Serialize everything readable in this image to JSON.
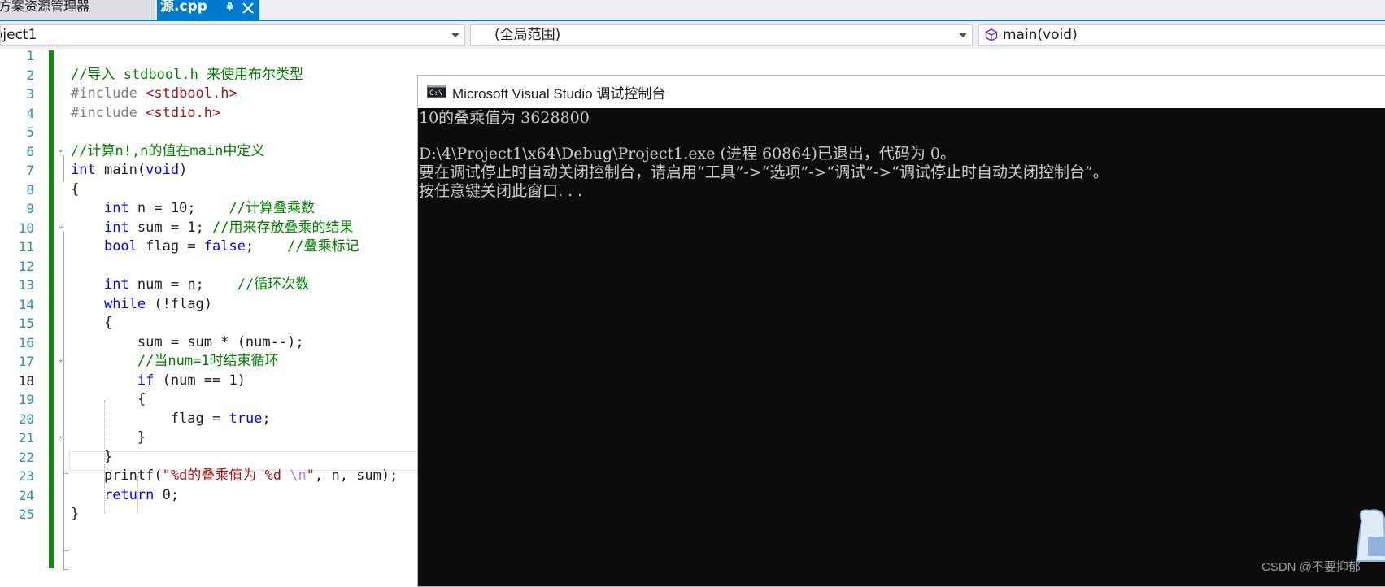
{
  "tabs": {
    "inactive_label": "方案资源管理器",
    "active_label": "源.cpp"
  },
  "navbar": {
    "project": "oject1",
    "scope": "(全局范围)",
    "member": "main(void)"
  },
  "editor": {
    "current_line": 18,
    "lines": [
      {
        "n": "1",
        "tokens": []
      },
      {
        "n": "2",
        "tokens": [
          {
            "t": "//导入 stdbool.h 来使用布尔类型",
            "c": "cm"
          }
        ]
      },
      {
        "n": "3",
        "tokens": [
          {
            "t": "#include ",
            "c": "pp"
          },
          {
            "t": "<stdbool.h>",
            "c": "str"
          }
        ]
      },
      {
        "n": "4",
        "tokens": [
          {
            "t": "#include ",
            "c": "pp"
          },
          {
            "t": "<stdio.h>",
            "c": "str"
          }
        ]
      },
      {
        "n": "5",
        "tokens": []
      },
      {
        "n": "6",
        "tokens": [
          {
            "t": "//计算n!,n的值在main中定义",
            "c": "cm"
          }
        ]
      },
      {
        "n": "7",
        "tokens": [
          {
            "t": "int",
            "c": "kw"
          },
          {
            "t": " main(",
            "c": "fn"
          },
          {
            "t": "void",
            "c": "kw"
          },
          {
            "t": ")",
            "c": "fn"
          }
        ]
      },
      {
        "n": "8",
        "tokens": [
          {
            "t": "{",
            "c": "fn"
          }
        ]
      },
      {
        "n": "9",
        "tokens": [
          {
            "t": "    ",
            "c": "fn"
          },
          {
            "t": "int",
            "c": "kw"
          },
          {
            "t": " n = 10;    ",
            "c": "fn"
          },
          {
            "t": "//计算叠乘数",
            "c": "cm"
          }
        ]
      },
      {
        "n": "10",
        "tokens": [
          {
            "t": "    ",
            "c": "fn"
          },
          {
            "t": "int",
            "c": "kw"
          },
          {
            "t": " sum = 1; ",
            "c": "fn"
          },
          {
            "t": "//用来存放叠乘的结果",
            "c": "cm"
          }
        ]
      },
      {
        "n": "11",
        "tokens": [
          {
            "t": "    ",
            "c": "fn"
          },
          {
            "t": "bool",
            "c": "kw"
          },
          {
            "t": " flag = ",
            "c": "fn"
          },
          {
            "t": "false",
            "c": "kw"
          },
          {
            "t": ";    ",
            "c": "fn"
          },
          {
            "t": "//叠乘标记",
            "c": "cm"
          }
        ]
      },
      {
        "n": "12",
        "tokens": []
      },
      {
        "n": "13",
        "tokens": [
          {
            "t": "    ",
            "c": "fn"
          },
          {
            "t": "int",
            "c": "kw"
          },
          {
            "t": " num = n;    ",
            "c": "fn"
          },
          {
            "t": "//循环次数",
            "c": "cm"
          }
        ]
      },
      {
        "n": "14",
        "tokens": [
          {
            "t": "    ",
            "c": "fn"
          },
          {
            "t": "while",
            "c": "kw"
          },
          {
            "t": " (!flag)",
            "c": "fn"
          }
        ]
      },
      {
        "n": "15",
        "tokens": [
          {
            "t": "    {",
            "c": "fn"
          }
        ]
      },
      {
        "n": "16",
        "tokens": [
          {
            "t": "        sum = sum * (num--);",
            "c": "fn"
          }
        ]
      },
      {
        "n": "17",
        "tokens": [
          {
            "t": "        ",
            "c": "fn"
          },
          {
            "t": "//当num=1时结束循环",
            "c": "cm"
          }
        ]
      },
      {
        "n": "18",
        "tokens": [
          {
            "t": "        ",
            "c": "fn"
          },
          {
            "t": "if",
            "c": "kw"
          },
          {
            "t": " (num == 1)",
            "c": "fn"
          }
        ]
      },
      {
        "n": "19",
        "tokens": [
          {
            "t": "        {",
            "c": "fn"
          }
        ]
      },
      {
        "n": "20",
        "tokens": [
          {
            "t": "            flag = ",
            "c": "fn"
          },
          {
            "t": "true",
            "c": "kw"
          },
          {
            "t": ";",
            "c": "fn"
          }
        ]
      },
      {
        "n": "21",
        "tokens": [
          {
            "t": "        }",
            "c": "fn"
          }
        ]
      },
      {
        "n": "22",
        "tokens": [
          {
            "t": "    }",
            "c": "fn"
          }
        ]
      },
      {
        "n": "23",
        "tokens": [
          {
            "t": "    printf(",
            "c": "fn"
          },
          {
            "t": "\"%d的叠乘值为 %d ",
            "c": "str"
          },
          {
            "t": "\\n",
            "c": "esc"
          },
          {
            "t": "\"",
            "c": "str"
          },
          {
            "t": ", n, sum);",
            "c": "fn"
          }
        ]
      },
      {
        "n": "24",
        "tokens": [
          {
            "t": "    ",
            "c": "fn"
          },
          {
            "t": "return",
            "c": "kw"
          },
          {
            "t": " 0;",
            "c": "fn"
          }
        ]
      },
      {
        "n": "25",
        "tokens": [
          {
            "t": "}",
            "c": "fn"
          }
        ]
      }
    ]
  },
  "console": {
    "title": "Microsoft Visual Studio 调试控制台",
    "lines": [
      "10的叠乘值为 3628800",
      "",
      "D:\\4\\Project1\\x64\\Debug\\Project1.exe (进程 60864)已退出，代码为 0。",
      "要在调试停止时自动关闭控制台，请启用“工具”->“选项”->“调试”->“调试停止时自动关闭控制台”。",
      "按任意键关闭此窗口. . ."
    ]
  },
  "watermark": "CSDN @不要抑郁",
  "icons": {
    "pin": "pin-icon",
    "close": "close-icon",
    "member": "cube-icon",
    "console_app": "console-app-icon"
  },
  "colors": {
    "accent": "#007acc",
    "keyword": "#0000ff",
    "comment": "#008000",
    "string": "#a31515",
    "preprocessor": "#808080",
    "line_number": "#2b91af",
    "change_bar": "#108b10",
    "console_bg": "#0c0c0c",
    "console_text": "#cccccc"
  }
}
